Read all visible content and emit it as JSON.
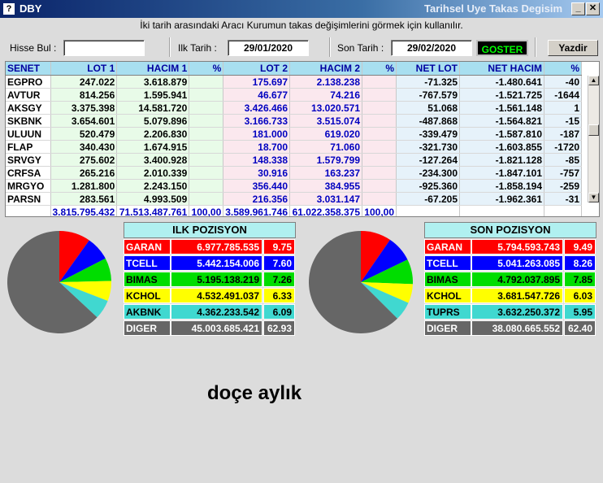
{
  "window": {
    "app_icon": "?",
    "app_title": "DBY",
    "title": "Tarihsel Uye Takas Degisim",
    "minimize_label": "_",
    "maximize_label": "□",
    "close_label": "✕"
  },
  "instructions": "İki tarih arasındaki  Aracı Kurumun takas değişimlerini görmek için kullanılır.",
  "form": {
    "hisse_label": "Hisse Bul :",
    "hisse_value": "",
    "ilk_label": "Ilk Tarih :",
    "ilk_value": "29/01/2020",
    "son_label": "Son Tarih :",
    "son_value": "29/02/2020",
    "goster_label": "GOSTER",
    "yazdir_label": "Yazdir"
  },
  "grid": {
    "headers": [
      "SENET",
      "LOT 1",
      "HACIM 1",
      "%",
      "LOT 2",
      "HACIM 2",
      "%",
      "NET LOT",
      "NET HACIM",
      "%"
    ],
    "rows": [
      [
        "EGPRO",
        "247.022",
        "3.618.879",
        "",
        "175.697",
        "2.138.238",
        "",
        "-71.325",
        "-1.480.641",
        "-40"
      ],
      [
        "AVTUR",
        "814.256",
        "1.595.941",
        "",
        "46.677",
        "74.216",
        "",
        "-767.579",
        "-1.521.725",
        "-1644"
      ],
      [
        "AKSGY",
        "3.375.398",
        "14.581.720",
        "",
        "3.426.466",
        "13.020.571",
        "",
        "51.068",
        "-1.561.148",
        "1"
      ],
      [
        "SKBNK",
        "3.654.601",
        "5.079.896",
        "",
        "3.166.733",
        "3.515.074",
        "",
        "-487.868",
        "-1.564.821",
        "-15"
      ],
      [
        "ULUUN",
        "520.479",
        "2.206.830",
        "",
        "181.000",
        "619.020",
        "",
        "-339.479",
        "-1.587.810",
        "-187"
      ],
      [
        "FLAP",
        "340.430",
        "1.674.915",
        "",
        "18.700",
        "71.060",
        "",
        "-321.730",
        "-1.603.855",
        "-1720"
      ],
      [
        "SRVGY",
        "275.602",
        "3.400.928",
        "",
        "148.338",
        "1.579.799",
        "",
        "-127.264",
        "-1.821.128",
        "-85"
      ],
      [
        "CRFSA",
        "265.216",
        "2.010.339",
        "",
        "30.916",
        "163.237",
        "",
        "-234.300",
        "-1.847.101",
        "-757"
      ],
      [
        "MRGYO",
        "1.281.800",
        "2.243.150",
        "",
        "356.440",
        "384.955",
        "",
        "-925.360",
        "-1.858.194",
        "-259"
      ],
      [
        "PARSN",
        "283.561",
        "4.993.509",
        "",
        "216.356",
        "3.031.147",
        "",
        "-67.205",
        "-1.962.361",
        "-31"
      ]
    ],
    "totals": [
      "",
      "3.815.795.432",
      "71.513.487.761",
      "100,00",
      "3.589.961.746",
      "61.022.358.375",
      "100,00",
      "",
      "",
      ""
    ]
  },
  "ilk_pozisyon": {
    "title": "ILK POZISYON",
    "rows": [
      {
        "name": "GARAN",
        "value": "6.977.785.535",
        "pct": "9.75",
        "color": "#ff0000"
      },
      {
        "name": "TCELL",
        "value": "5.442.154.006",
        "pct": "7.60",
        "color": "#0000ff"
      },
      {
        "name": "BIMAS",
        "value": "5.195.138.219",
        "pct": "7.26",
        "color": "#00dd00"
      },
      {
        "name": "KCHOL",
        "value": "4.532.491.037",
        "pct": "6.33",
        "color": "#ffff00"
      },
      {
        "name": "AKBNK",
        "value": "4.362.233.542",
        "pct": "6.09",
        "color": "#40d8d0"
      },
      {
        "name": "DIGER",
        "value": "45.003.685.421",
        "pct": "62.93",
        "color": "#666666"
      }
    ]
  },
  "son_pozisyon": {
    "title": "SON POZISYON",
    "rows": [
      {
        "name": "GARAN",
        "value": "5.794.593.743",
        "pct": "9.49",
        "color": "#ff0000"
      },
      {
        "name": "TCELL",
        "value": "5.041.263.085",
        "pct": "8.26",
        "color": "#0000ff"
      },
      {
        "name": "BIMAS",
        "value": "4.792.037.895",
        "pct": "7.85",
        "color": "#00dd00"
      },
      {
        "name": "KCHOL",
        "value": "3.681.547.726",
        "pct": "6.03",
        "color": "#ffff00"
      },
      {
        "name": "TUPRS",
        "value": "3.632.250.372",
        "pct": "5.95",
        "color": "#40d8d0"
      },
      {
        "name": "DIGER",
        "value": "38.080.665.552",
        "pct": "62.40",
        "color": "#666666"
      }
    ]
  },
  "caption": "doçe aylık"
}
